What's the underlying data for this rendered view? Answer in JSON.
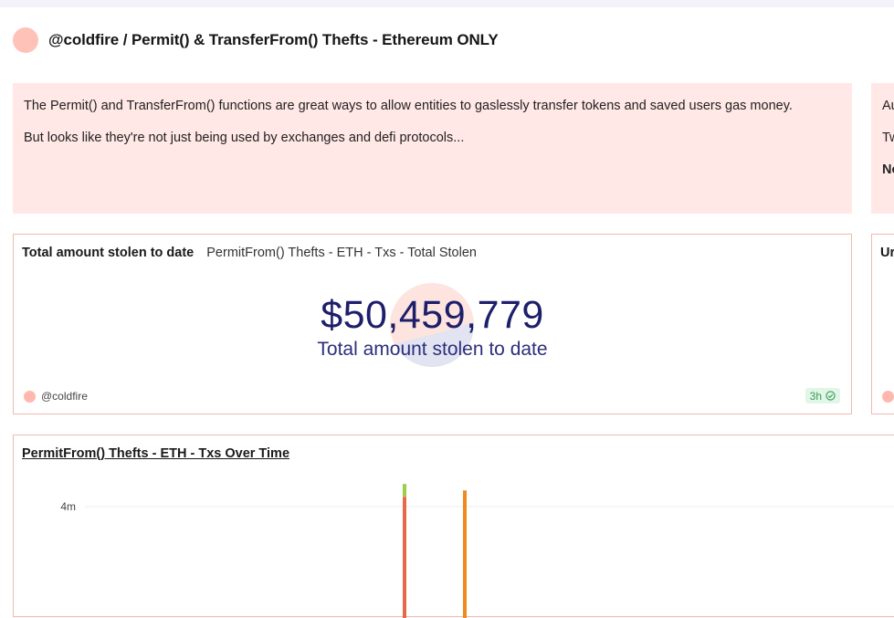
{
  "header": {
    "title": "@coldfire / Permit() & TransferFrom() Thefts - Ethereum ONLY"
  },
  "text_card": {
    "paragraphs": [
      "The Permit() and TransferFrom() functions are great ways to allow entities to gaslessly transfer tokens and saved users gas money.",
      "But looks like they're not just being used by exchanges and defi protocols..."
    ]
  },
  "side_text_card": {
    "lines": [
      "Au",
      "Tw",
      "No"
    ]
  },
  "counter_card": {
    "title": "Total amount stolen to date",
    "query_name": "PermitFrom() Thefts - ETH - Txs - Total Stolen",
    "value": "$50,459,779",
    "subtitle": "Total amount stolen to date",
    "author": "@coldfire",
    "freshness": "3h"
  },
  "side_counter_card": {
    "title": "Ur"
  },
  "chart_card": {
    "title": "PermitFrom() Thefts - ETH - Txs Over Time"
  },
  "chart_data": {
    "type": "bar",
    "title": "PermitFrom() Thefts - ETH - Txs Over Time",
    "y_tick_labels": [
      "4m"
    ],
    "series": [
      {
        "color": "#e8694a",
        "values": [
          4.3,
          0
        ]
      },
      {
        "color": "#9bcf4a",
        "values": [
          0.4,
          0
        ]
      },
      {
        "color": "#ef8a1e",
        "values": [
          0,
          4.5
        ]
      }
    ],
    "bar_index_positions": [
      0,
      1
    ],
    "colors": {
      "accent": "#ffc2b8",
      "card_border": "#f3b8b0",
      "number": "#1d1f6b",
      "badge_green": "#3a9a55"
    }
  }
}
